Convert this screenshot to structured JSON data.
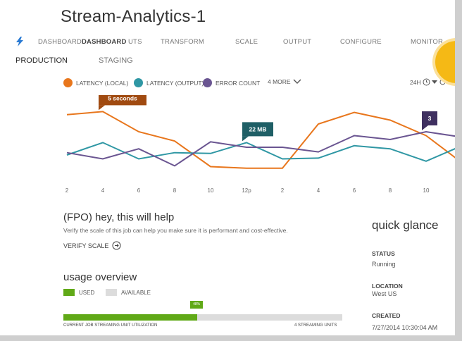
{
  "title": "Stream-Analytics-1",
  "nav": {
    "tabs": [
      "DASHBOARD",
      "DASHBOARD",
      "UTS",
      "TRANSFORM",
      "SCALE",
      "OUTPUT",
      "CONFIGURE",
      "MONITOR"
    ]
  },
  "subnav": [
    "PRODUCTION",
    "STAGING"
  ],
  "legend": {
    "items": [
      {
        "label": "LATENCY (LOCAL)",
        "color": "#e8761c"
      },
      {
        "label": "LATENCY (OUTPUT)",
        "color": "#2f97a4"
      },
      {
        "label": "ERROR COUNT",
        "color": "#6a5591"
      }
    ],
    "more": "4 MORE"
  },
  "range": "24H",
  "chart_data": {
    "type": "line",
    "x": [
      "2",
      "4",
      "6",
      "8",
      "10",
      "12p",
      "2",
      "4",
      "6",
      "8",
      "10",
      ""
    ],
    "series": [
      {
        "name": "LATENCY (LOCAL)",
        "color": "#e8761c",
        "values": [
          82,
          86,
          60,
          48,
          15,
          13,
          13,
          70,
          85,
          75,
          55,
          20
        ]
      },
      {
        "name": "LATENCY (OUTPUT)",
        "color": "#2f97a4",
        "values": [
          30,
          46,
          25,
          33,
          32,
          46,
          25,
          26,
          42,
          38,
          22,
          42
        ]
      },
      {
        "name": "ERROR COUNT",
        "color": "#6a5591",
        "values": [
          33,
          25,
          38,
          16,
          47,
          40,
          40,
          34,
          55,
          50,
          60,
          53
        ]
      }
    ],
    "callouts": [
      {
        "text": "5 seconds",
        "series": 0,
        "index": 1,
        "color": "#a04a10"
      },
      {
        "text": "22 MB",
        "series": 1,
        "index": 5,
        "color": "#1f5f66"
      },
      {
        "text": "3",
        "series": 2,
        "index": 10,
        "color": "#3f3060"
      }
    ],
    "ylim": [
      0,
      100
    ]
  },
  "fpo": {
    "heading": "(FPO) hey, this will help",
    "text": "Verify the scale of this job can help you make sure it is performant and cost-effective.",
    "link": "VERIFY SCALE"
  },
  "glance": {
    "title": "quick glance",
    "status_label": "STATUS",
    "status": "Running",
    "location_label": "LOCATION",
    "location": "West US",
    "created_label": "CREATED",
    "created": "7/27/2014 10:30:04 AM"
  },
  "usage": {
    "title": "usage overview",
    "used_label": "USED",
    "available_label": "AVAILABLE",
    "used_color": "#60a917",
    "available_color": "#dcdcdc",
    "percent": 48,
    "percent_label": "48%",
    "caption_left": "CURRENT JOB STREAMING UNIT UTILIZATION",
    "caption_right": "4 STREAMING UNITS"
  }
}
